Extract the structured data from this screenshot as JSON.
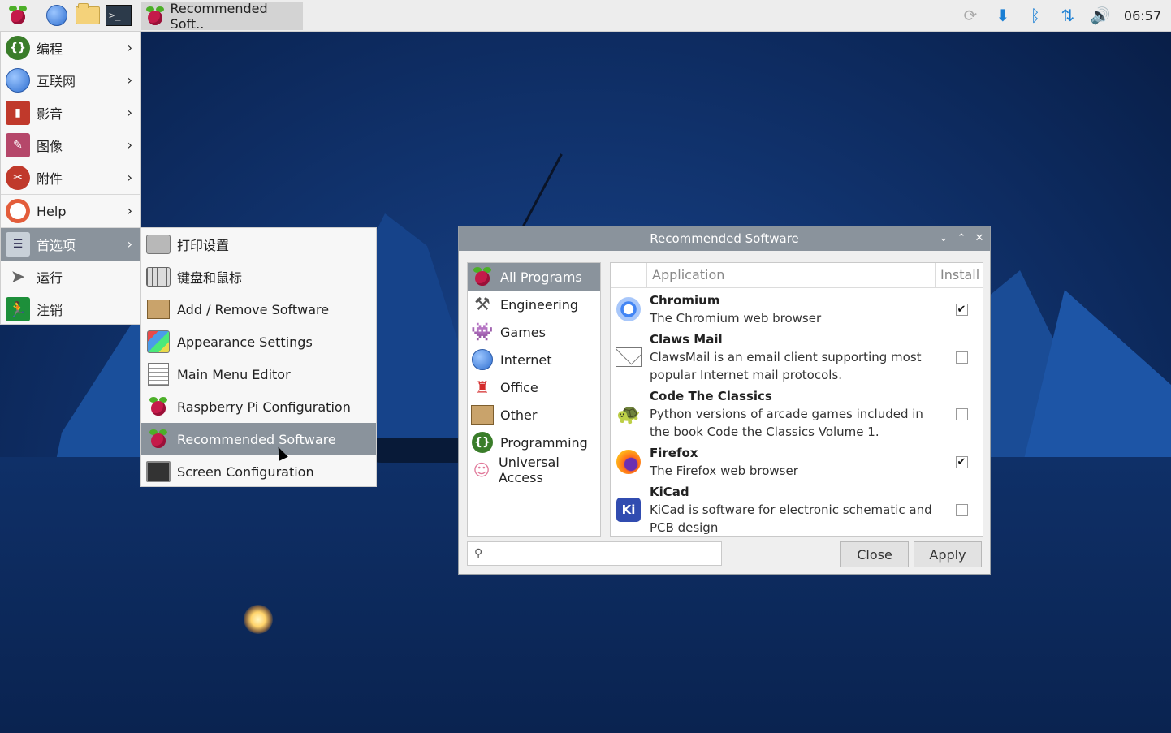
{
  "taskbar": {
    "active_task": "Recommended Soft..",
    "clock": "06:57",
    "launchers": [
      "rpi-menu-icon",
      "globe-icon",
      "folder-icon",
      "terminal-icon"
    ],
    "terminal_glyph": ">_"
  },
  "main_menu": {
    "items": [
      {
        "label": "编程",
        "icon": "programming-icon",
        "color": "#3a7d2a"
      },
      {
        "label": "互联网",
        "icon": "globe-icon",
        "color": "#2f6fd0"
      },
      {
        "label": "影音",
        "icon": "media-icon",
        "color": "#c0392b"
      },
      {
        "label": "图像",
        "icon": "paintbrush-icon",
        "color": "#b5476a"
      },
      {
        "label": "附件",
        "icon": "accessories-icon",
        "color": "#c0392b"
      },
      {
        "label": "Help",
        "icon": "lifebuoy-icon",
        "color": "#e35d3b"
      },
      {
        "label": "首选项",
        "icon": "preferences-icon",
        "color": "#7f8c8d"
      },
      {
        "label": "运行",
        "icon": "run-icon",
        "color": "#666666"
      },
      {
        "label": "注销",
        "icon": "logout-icon",
        "color": "#1d8f3a"
      }
    ]
  },
  "submenu": {
    "items": [
      {
        "label": "打印设置",
        "icon": "printer-icon"
      },
      {
        "label": "键盘和鼠标",
        "icon": "keyboard-icon"
      },
      {
        "label": "Add / Remove Software",
        "icon": "package-icon"
      },
      {
        "label": "Appearance Settings",
        "icon": "palette-icon"
      },
      {
        "label": "Main Menu Editor",
        "icon": "menu-editor-icon"
      },
      {
        "label": "Raspberry Pi Configuration",
        "icon": "rpi-icon"
      },
      {
        "label": "Recommended Software",
        "icon": "rpi-icon"
      },
      {
        "label": "Screen Configuration",
        "icon": "monitor-icon"
      }
    ]
  },
  "dialog": {
    "title": "Recommended Software",
    "categories": [
      {
        "label": "All Programs",
        "icon": "rpi-icon"
      },
      {
        "label": "Engineering",
        "icon": "compass-icon"
      },
      {
        "label": "Games",
        "icon": "invader-icon"
      },
      {
        "label": "Internet",
        "icon": "globe-icon"
      },
      {
        "label": "Office",
        "icon": "lamp-icon"
      },
      {
        "label": "Other",
        "icon": "box-icon"
      },
      {
        "label": "Programming",
        "icon": "programming-icon"
      },
      {
        "label": "Universal Access",
        "icon": "person-icon"
      }
    ],
    "columns": {
      "application": "Application",
      "install": "Install"
    },
    "apps": [
      {
        "name": "Chromium",
        "desc": "The Chromium web browser",
        "installed": true,
        "icon": "chromium-icon"
      },
      {
        "name": "Claws Mail",
        "desc": "ClawsMail is an email client supporting most popular Internet mail protocols.",
        "installed": false,
        "icon": "mail-icon"
      },
      {
        "name": "Code The Classics",
        "desc": "Python versions of arcade games included in the book Code the Classics Volume 1.",
        "installed": false,
        "icon": "turtle-icon"
      },
      {
        "name": "Firefox",
        "desc": "The Firefox web browser",
        "installed": true,
        "icon": "firefox-icon"
      },
      {
        "name": "KiCad",
        "desc": "KiCad is software for electronic schematic and PCB design",
        "installed": false,
        "icon": "kicad-icon"
      }
    ],
    "search_placeholder": "",
    "close_label": "Close",
    "apply_label": "Apply",
    "kicad_icon_text": "Ki",
    "check_glyph": "✔"
  }
}
